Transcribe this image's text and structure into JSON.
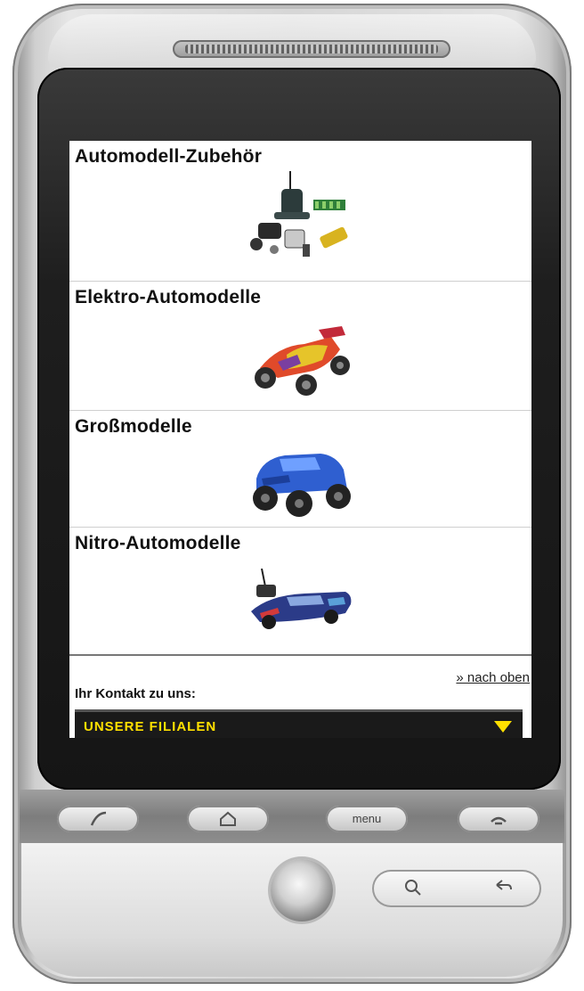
{
  "categories": [
    {
      "title": "Automodell-Zubehör"
    },
    {
      "title": "Elektro-Automodelle"
    },
    {
      "title": "Großmodelle"
    },
    {
      "title": "Nitro-Automodelle"
    }
  ],
  "footer": {
    "to_top": "» nach oben",
    "contact_label": "Ihr Kontakt zu uns:",
    "branches_label": "UNSERE FILIALEN"
  },
  "hardware_keys": {
    "menu_label": "menu"
  },
  "colors": {
    "branches_bar": "#1a1a1a",
    "branches_text": "#ffe000"
  }
}
